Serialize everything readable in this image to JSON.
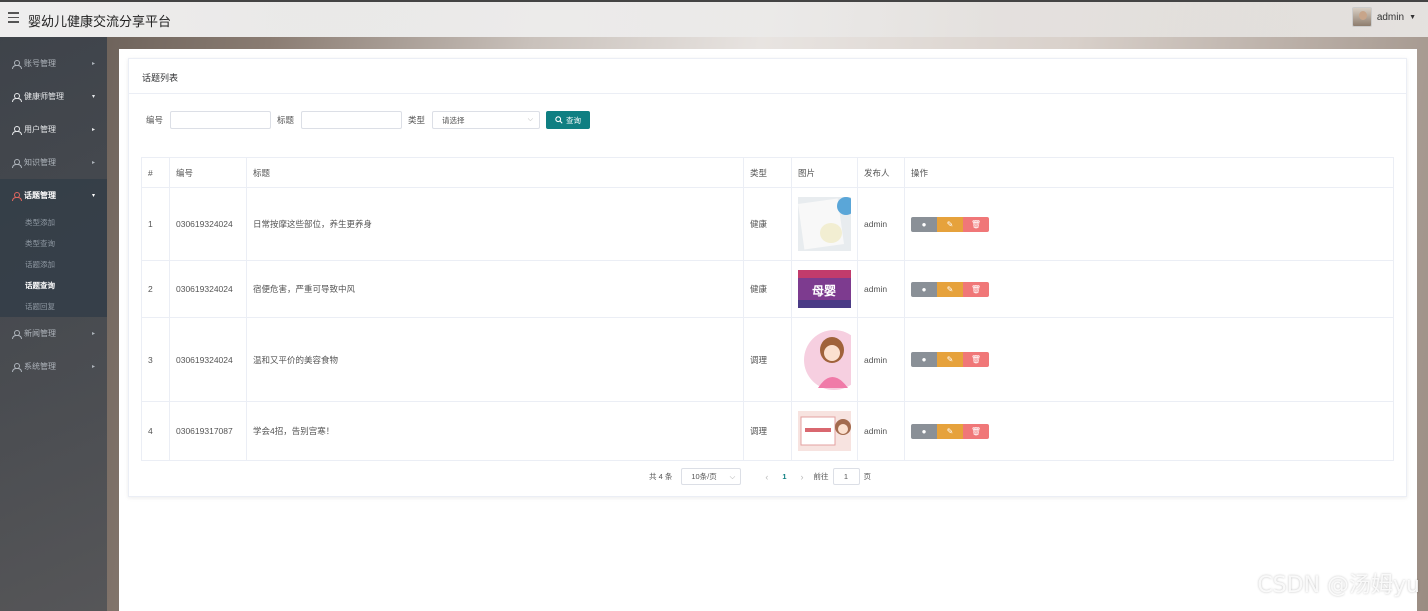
{
  "header": {
    "title": "婴幼儿健康交流分享平台",
    "user": "admin"
  },
  "sidebar": {
    "items": [
      {
        "label": "账号管理",
        "arrow": "▸"
      },
      {
        "label": "健康师管理",
        "arrow": "▾"
      },
      {
        "label": "用户管理",
        "arrow": "▸"
      },
      {
        "label": "知识管理",
        "arrow": "▸"
      },
      {
        "label": "话题管理",
        "arrow": "▾",
        "active": true,
        "children": [
          "类型添加",
          "类型查询",
          "话题添加",
          "话题查询",
          "话题回复"
        ],
        "current": "话题查询"
      },
      {
        "label": "新闻管理",
        "arrow": "▸"
      },
      {
        "label": "系统管理",
        "arrow": "▸"
      }
    ]
  },
  "card": {
    "title": "话题列表"
  },
  "filters": {
    "id_label": "编号",
    "title_label": "标题",
    "type_label": "类型",
    "type_placeholder": "请选择",
    "search_label": "查询"
  },
  "table": {
    "columns": [
      "#",
      "编号",
      "标题",
      "类型",
      "图片",
      "发布人",
      "操作"
    ],
    "rows": [
      {
        "idx": "1",
        "code": "030619324024",
        "title": "日常按摩这些部位，养生更养身",
        "type": "健康",
        "author": "admin"
      },
      {
        "idx": "2",
        "code": "030619324024",
        "title": "宿便危害，严重可导致中风",
        "type": "健康",
        "author": "admin"
      },
      {
        "idx": "3",
        "code": "030619324024",
        "title": "温和又平价的美容食物",
        "type": "调理",
        "author": "admin"
      },
      {
        "idx": "4",
        "code": "030619317087",
        "title": "学会4招，告别宫寒！",
        "type": "调理",
        "author": "admin"
      }
    ]
  },
  "pagination": {
    "total": "共 4 条",
    "size": "10条/页",
    "page": "1",
    "goto": "前往",
    "goto_value": "1",
    "suffix": "页"
  },
  "thumb2_text": "母婴",
  "watermark": "CSDN @汤姆yu"
}
